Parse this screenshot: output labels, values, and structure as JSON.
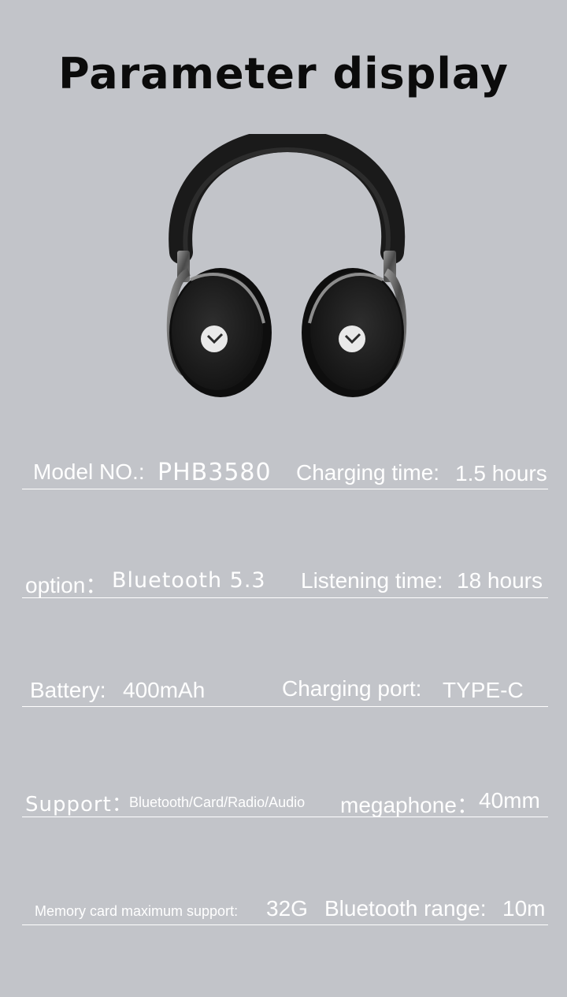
{
  "title": "Parameter display",
  "colors": {
    "background": "#c2c4c9",
    "title": "#0b0b0b",
    "spec_text": "#ffffff"
  },
  "product_image": "over-ear-headphones-black",
  "specs": {
    "model_label": "Model NO.:",
    "model_value": "PHB3580",
    "charging_time_label": "Charging time:",
    "charging_time_value": "1.5 hours",
    "option_label": "option：",
    "option_value": "Bluetooth 5.3",
    "listening_time_label": "Listening time:",
    "listening_time_value": "18 hours",
    "battery_label": "Battery:",
    "battery_value": "400mAh",
    "charging_port_label": "Charging port:",
    "charging_port_value": "TYPE-C",
    "support_label": "Support：",
    "support_value": "Bluetooth/Card/Radio/Audio",
    "megaphone_label": "megaphone：",
    "megaphone_value": "40mm",
    "memory_label": "Memory card maximum support:",
    "memory_value": "32G",
    "bt_range_label": "Bluetooth range:",
    "bt_range_value": "10m"
  }
}
